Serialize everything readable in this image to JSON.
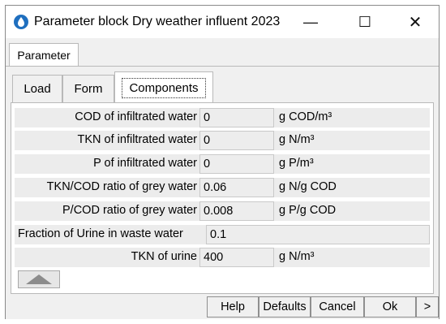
{
  "window": {
    "title": "Parameter block Dry weather influent 2023",
    "min_glyph": "—",
    "max_glyph": "☐",
    "close_glyph": "✕"
  },
  "outer_tabs": [
    {
      "label": "Parameter",
      "selected": true
    }
  ],
  "inner_tabs": [
    {
      "label": "Load",
      "selected": false
    },
    {
      "label": "Form",
      "selected": false
    },
    {
      "label": "Components",
      "selected": true
    }
  ],
  "rows": [
    {
      "label": "COD of infiltrated water",
      "value": "0",
      "unit": "g COD/m³"
    },
    {
      "label": "TKN of infiltrated water",
      "value": "0",
      "unit": "g N/m³"
    },
    {
      "label": "P of infiltrated water",
      "value": "0",
      "unit": "g P/m³"
    },
    {
      "label": "TKN/COD ratio of grey water",
      "value": "0.06",
      "unit": "g N/g COD"
    },
    {
      "label": "P/COD ratio of grey water",
      "value": "0.008",
      "unit": "g P/g COD"
    },
    {
      "label": "Fraction of Urine in waste water",
      "value": "0.1",
      "unit": ""
    },
    {
      "label": "TKN of urine",
      "value": "400",
      "unit": "g N/m³"
    }
  ],
  "buttons": {
    "help": "Help",
    "defaults": "Defaults",
    "cancel": "Cancel",
    "ok": "Ok",
    "more": ">"
  },
  "colors": {
    "app_icon": "#1f6fbf",
    "panel_bg": "#f0f0f0",
    "row_bg": "#ececec"
  },
  "icons": {
    "app": "water-drop-icon",
    "scroll": "triangle-up-icon"
  }
}
